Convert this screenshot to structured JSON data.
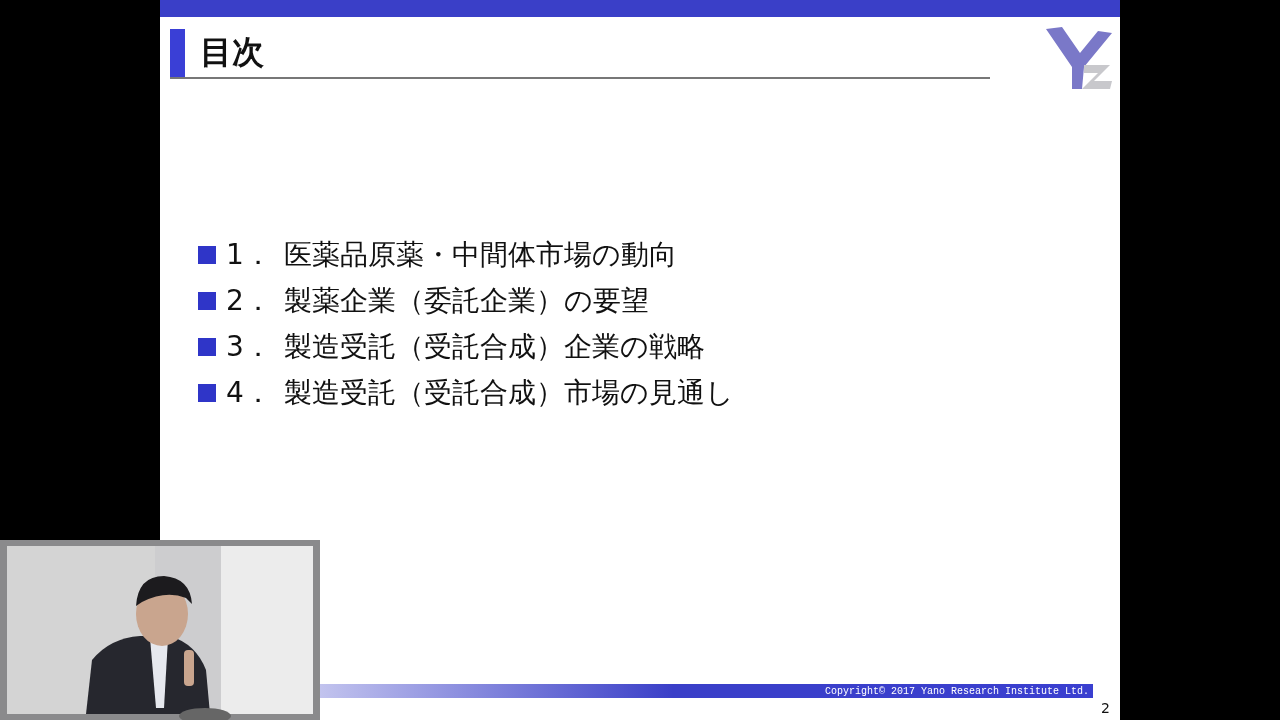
{
  "slide": {
    "title": "目次",
    "items": [
      {
        "number": "1．",
        "text": "医薬品原薬・中間体市場の動向"
      },
      {
        "number": "2．",
        "text": "製薬企業（委託企業）の要望"
      },
      {
        "number": "3．",
        "text": "製造受託（受託合成）企業の戦略"
      },
      {
        "number": "4．",
        "text": "製造受託（受託合成）市場の見通し"
      }
    ],
    "copyright": "Copyright© 2017 Yano Research Institute Ltd.",
    "page_number": "2"
  }
}
